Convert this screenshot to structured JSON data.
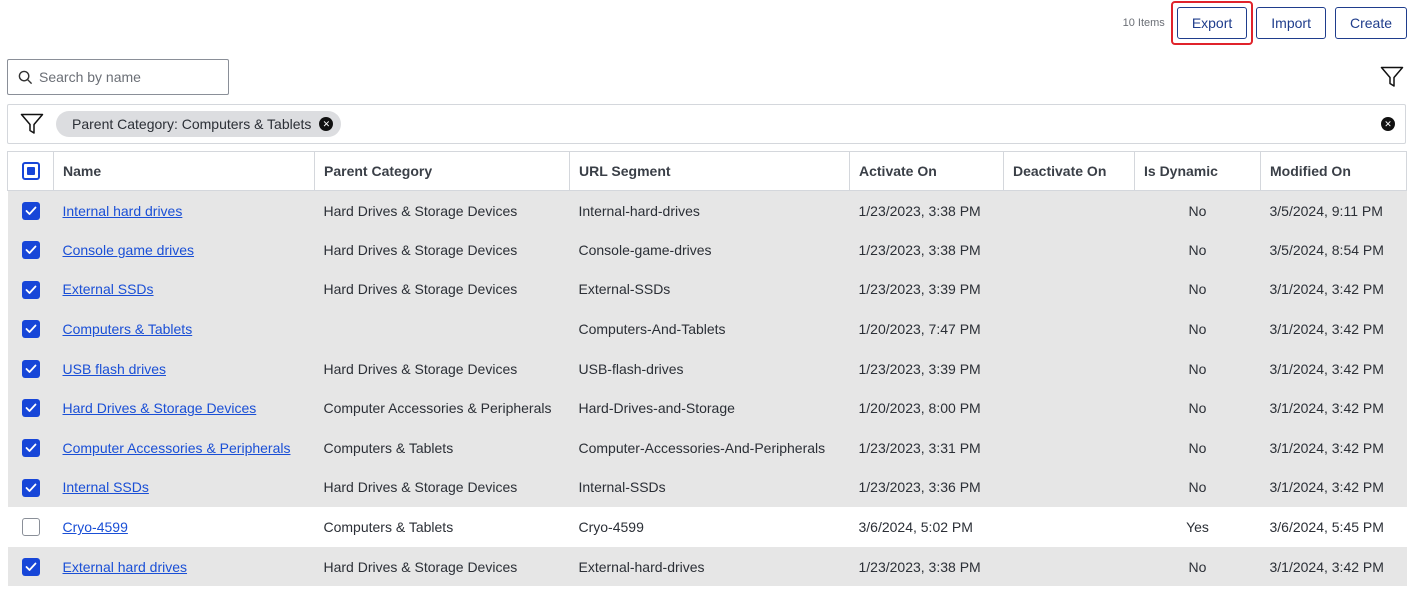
{
  "toolbar": {
    "items_count": "10 Items",
    "export_label": "Export",
    "import_label": "Import",
    "create_label": "Create"
  },
  "search": {
    "placeholder": "Search by name",
    "value": ""
  },
  "filters": {
    "chips": [
      {
        "label": "Parent Category: Computers & Tablets"
      }
    ]
  },
  "table": {
    "columns": [
      "Name",
      "Parent Category",
      "URL Segment",
      "Activate On",
      "Deactivate On",
      "Is Dynamic",
      "Modified On"
    ],
    "rows": [
      {
        "selected": true,
        "name": "Internal hard drives",
        "parent": "Hard Drives & Storage Devices",
        "url": "Internal-hard-drives",
        "activate": "1/23/2023, 3:38 PM",
        "deactivate": "",
        "dynamic": "No",
        "modified": "3/5/2024, 9:11 PM"
      },
      {
        "selected": true,
        "name": "Console game drives",
        "parent": "Hard Drives & Storage Devices",
        "url": "Console-game-drives",
        "activate": "1/23/2023, 3:38 PM",
        "deactivate": "",
        "dynamic": "No",
        "modified": "3/5/2024, 8:54 PM"
      },
      {
        "selected": true,
        "name": "External SSDs",
        "parent": "Hard Drives & Storage Devices",
        "url": "External-SSDs",
        "activate": "1/23/2023, 3:39 PM",
        "deactivate": "",
        "dynamic": "No",
        "modified": "3/1/2024, 3:42 PM"
      },
      {
        "selected": true,
        "name": "Computers & Tablets",
        "parent": "",
        "url": "Computers-And-Tablets",
        "activate": "1/20/2023, 7:47 PM",
        "deactivate": "",
        "dynamic": "No",
        "modified": "3/1/2024, 3:42 PM"
      },
      {
        "selected": true,
        "name": "USB flash drives",
        "parent": "Hard Drives & Storage Devices",
        "url": "USB-flash-drives",
        "activate": "1/23/2023, 3:39 PM",
        "deactivate": "",
        "dynamic": "No",
        "modified": "3/1/2024, 3:42 PM"
      },
      {
        "selected": true,
        "name": "Hard Drives & Storage Devices",
        "parent": "Computer Accessories & Peripherals",
        "url": "Hard-Drives-and-Storage",
        "activate": "1/20/2023, 8:00 PM",
        "deactivate": "",
        "dynamic": "No",
        "modified": "3/1/2024, 3:42 PM"
      },
      {
        "selected": true,
        "name": "Computer Accessories & Peripherals",
        "parent": "Computers & Tablets",
        "url": "Computer-Accessories-And-Peripherals",
        "activate": "1/23/2023, 3:31 PM",
        "deactivate": "",
        "dynamic": "No",
        "modified": "3/1/2024, 3:42 PM"
      },
      {
        "selected": true,
        "name": "Internal SSDs",
        "parent": "Hard Drives & Storage Devices",
        "url": "Internal-SSDs",
        "activate": "1/23/2023, 3:36 PM",
        "deactivate": "",
        "dynamic": "No",
        "modified": "3/1/2024, 3:42 PM"
      },
      {
        "selected": false,
        "name": "Cryo-4599",
        "parent": "Computers & Tablets",
        "url": "Cryo-4599",
        "activate": "3/6/2024, 5:02 PM",
        "deactivate": "",
        "dynamic": "Yes",
        "modified": "3/6/2024, 5:45 PM"
      },
      {
        "selected": true,
        "name": "External hard drives",
        "parent": "Hard Drives & Storage Devices",
        "url": "External-hard-drives",
        "activate": "1/23/2023, 3:38 PM",
        "deactivate": "",
        "dynamic": "No",
        "modified": "3/1/2024, 3:42 PM"
      }
    ]
  },
  "colors": {
    "accent": "#1746d8",
    "link": "#1a4fd6",
    "highlight": "#e0232b",
    "selected_row": "#e6e6e6"
  },
  "icons": {
    "search": "search-icon",
    "filter": "filter-icon",
    "check": "check-icon",
    "clear": "close-icon"
  }
}
